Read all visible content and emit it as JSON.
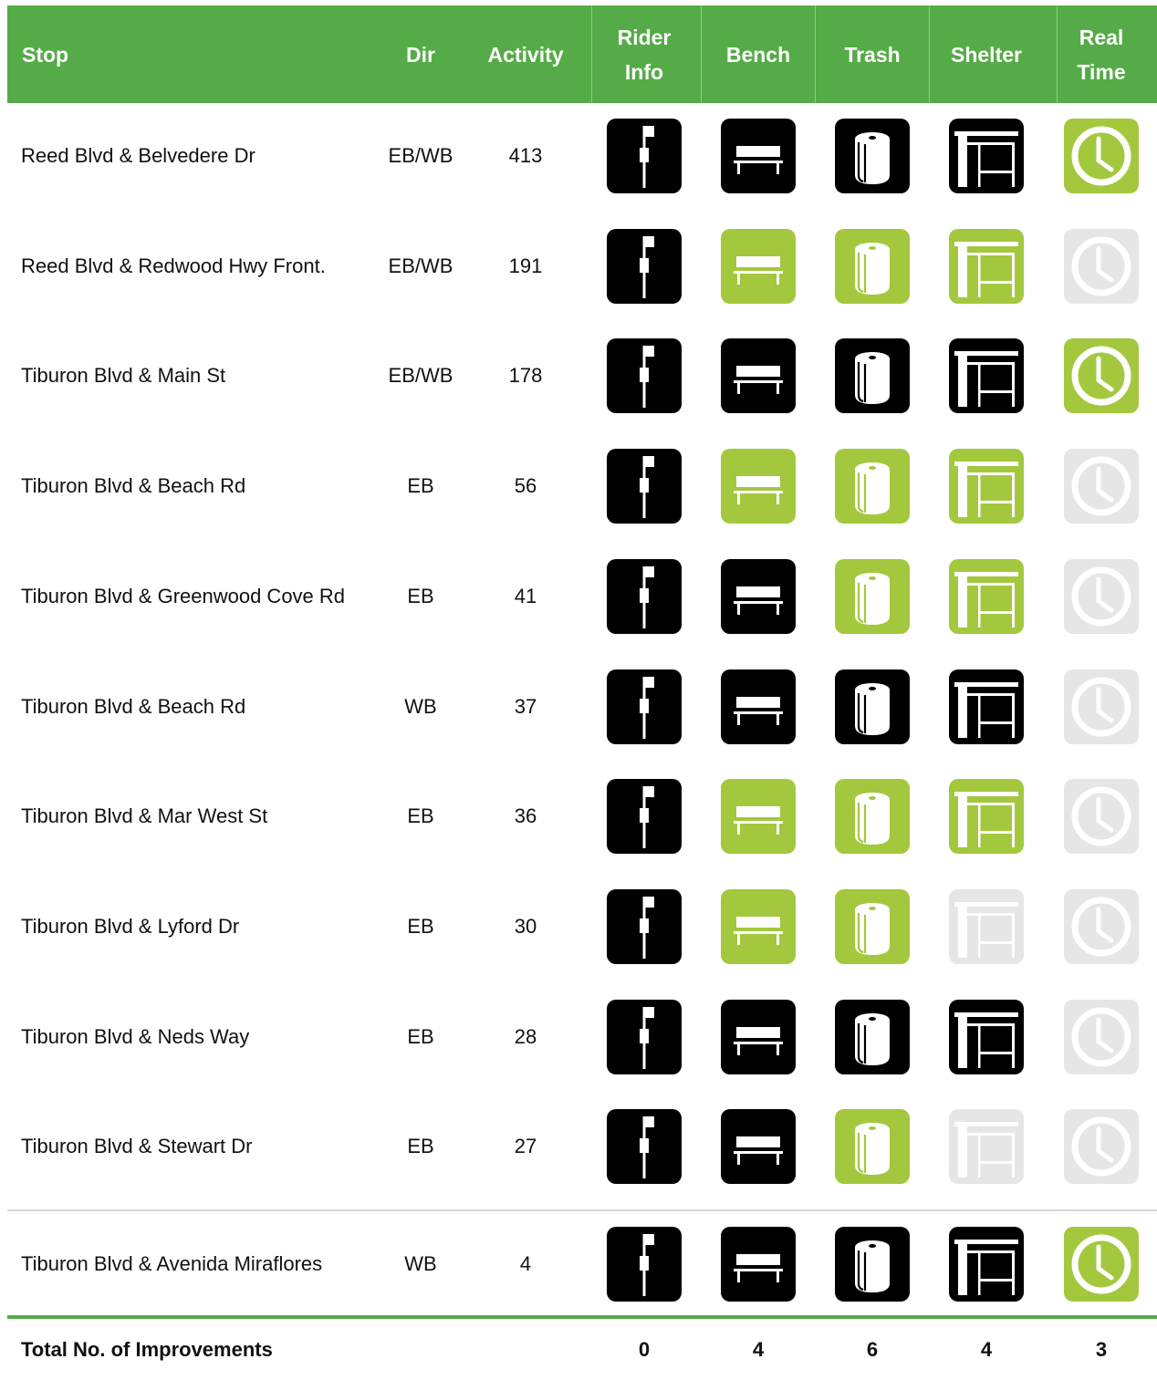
{
  "colors": {
    "header_green": "#55ab47",
    "proposed_green": "#a3c83e",
    "existing_black": "#000000",
    "not_applicable_gray": "#e6e6e6"
  },
  "headers": {
    "stop": "Stop",
    "dir": "Dir",
    "activity": "Activity",
    "rider_info": "Rider Info",
    "bench": "Bench",
    "trash": "Trash",
    "shelter": "Shelter",
    "real_time": "Real Time"
  },
  "rows": [
    {
      "stop": "Reed Blvd & Belvedere Dr",
      "dir": "EB/WB",
      "activity": "413",
      "rider_info": "existing",
      "bench": "existing",
      "trash": "existing",
      "shelter": "existing",
      "real_time": "proposed"
    },
    {
      "stop": "Reed Blvd & Redwood Hwy Front.",
      "dir": "EB/WB",
      "activity": "191",
      "rider_info": "existing",
      "bench": "proposed",
      "trash": "proposed",
      "shelter": "proposed",
      "real_time": "none"
    },
    {
      "stop": "Tiburon Blvd & Main St",
      "dir": "EB/WB",
      "activity": "178",
      "rider_info": "existing",
      "bench": "existing",
      "trash": "existing",
      "shelter": "existing",
      "real_time": "proposed"
    },
    {
      "stop": "Tiburon Blvd & Beach Rd",
      "dir": "EB",
      "activity": "56",
      "rider_info": "existing",
      "bench": "proposed",
      "trash": "proposed",
      "shelter": "proposed",
      "real_time": "none"
    },
    {
      "stop": "Tiburon Blvd & Greenwood Cove Rd",
      "dir": "EB",
      "activity": "41",
      "rider_info": "existing",
      "bench": "existing",
      "trash": "proposed",
      "shelter": "proposed",
      "real_time": "none"
    },
    {
      "stop": "Tiburon Blvd & Beach Rd",
      "dir": "WB",
      "activity": "37",
      "rider_info": "existing",
      "bench": "existing",
      "trash": "existing",
      "shelter": "existing",
      "real_time": "none"
    },
    {
      "stop": "Tiburon Blvd & Mar West St",
      "dir": "EB",
      "activity": "36",
      "rider_info": "existing",
      "bench": "proposed",
      "trash": "proposed",
      "shelter": "proposed",
      "real_time": "none"
    },
    {
      "stop": "Tiburon Blvd & Lyford Dr",
      "dir": "EB",
      "activity": "30",
      "rider_info": "existing",
      "bench": "proposed",
      "trash": "proposed",
      "shelter": "none",
      "real_time": "none"
    },
    {
      "stop": "Tiburon Blvd & Neds Way",
      "dir": "EB",
      "activity": "28",
      "rider_info": "existing",
      "bench": "existing",
      "trash": "existing",
      "shelter": "existing",
      "real_time": "none"
    },
    {
      "stop": "Tiburon Blvd & Stewart Dr",
      "dir": "EB",
      "activity": "27",
      "rider_info": "existing",
      "bench": "existing",
      "trash": "proposed",
      "shelter": "none",
      "real_time": "none"
    },
    {
      "stop": "Tiburon Blvd & Avenida Miraflores",
      "dir": "WB",
      "activity": "4",
      "rider_info": "existing",
      "bench": "existing",
      "trash": "existing",
      "shelter": "existing",
      "real_time": "proposed"
    }
  ],
  "totals": {
    "label": "Total No. of Improvements",
    "rider_info": "0",
    "bench": "4",
    "trash": "6",
    "shelter": "4",
    "real_time": "3"
  }
}
